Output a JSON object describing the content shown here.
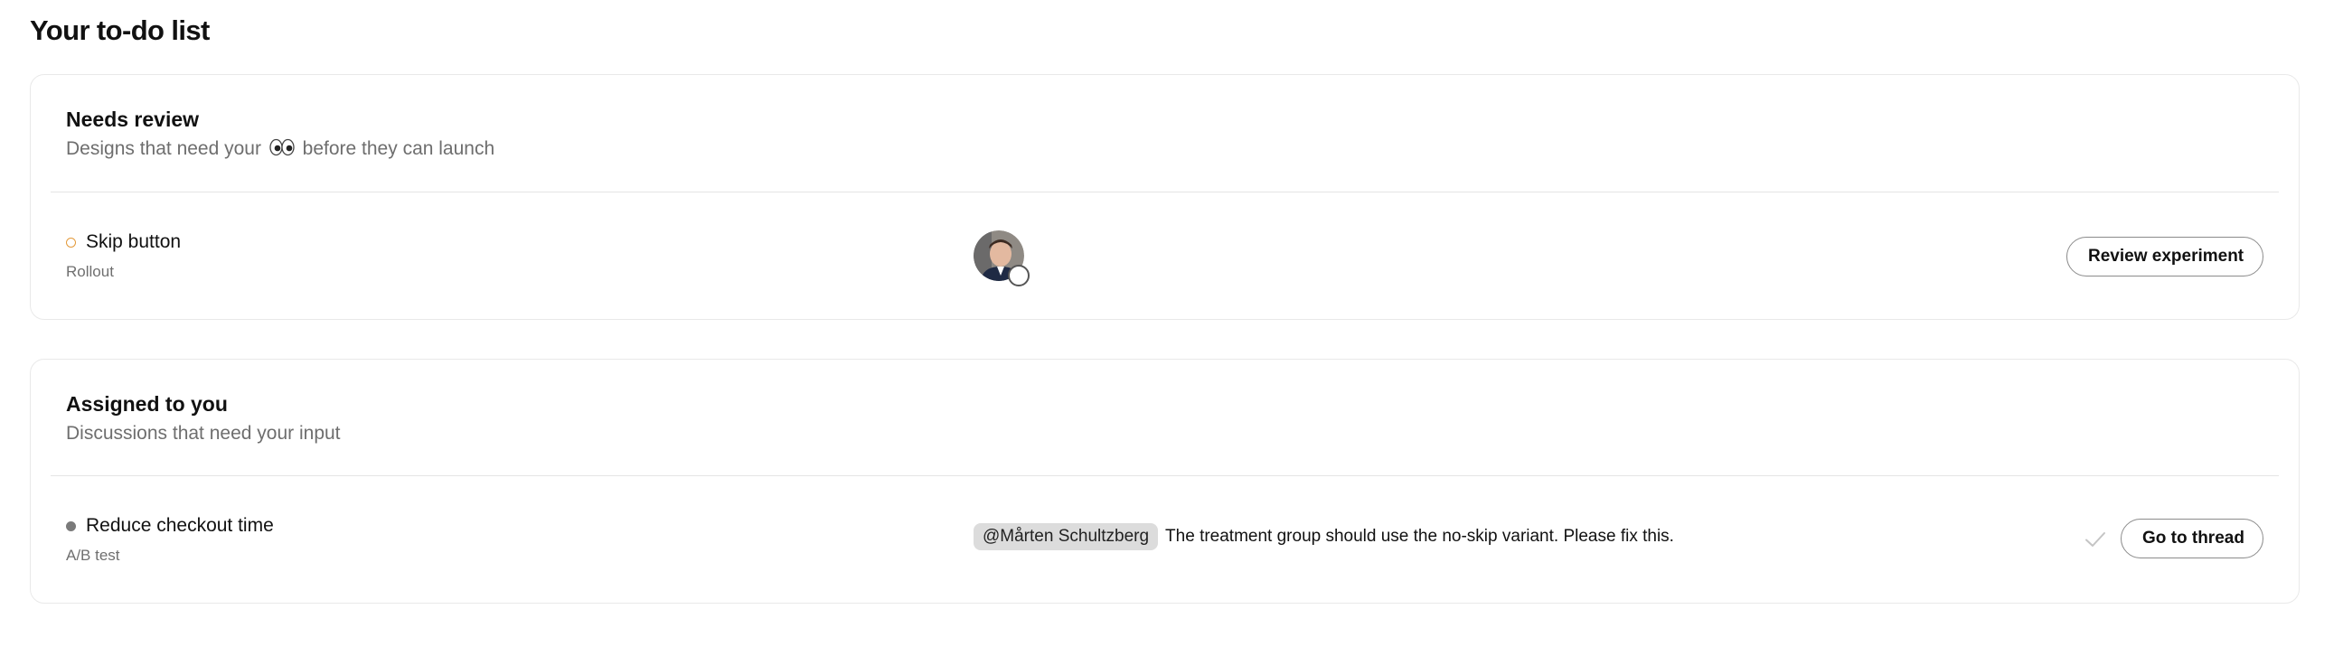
{
  "page": {
    "title": "Your to-do list"
  },
  "needs_review": {
    "title": "Needs review",
    "subtitle_before": "Designs that need your",
    "subtitle_emoji": "eyes-emoji",
    "subtitle_after": "before they can launch",
    "items": [
      {
        "name": "Skip button",
        "type": "Rollout",
        "status": "open-orange-circle",
        "reviewer_avatar": "reviewer-photo",
        "action_label": "Review experiment"
      }
    ]
  },
  "assigned": {
    "title": "Assigned to you",
    "subtitle": "Discussions that need your input",
    "items": [
      {
        "name": "Reduce checkout time",
        "type": "A/B test",
        "status": "filled-gray-dot",
        "mention": "@Mårten Schultzberg",
        "message": "The treatment group should use the no-skip variant. Please fix this.",
        "resolve_icon": "check-icon",
        "action_label": "Go to thread"
      }
    ]
  },
  "colors": {
    "status_open": "#e39a3b",
    "status_filled": "#7a7a7a",
    "mention_bg": "#dcdcdc",
    "border": "#e9e9e9",
    "muted_text": "#6e6e6e"
  }
}
